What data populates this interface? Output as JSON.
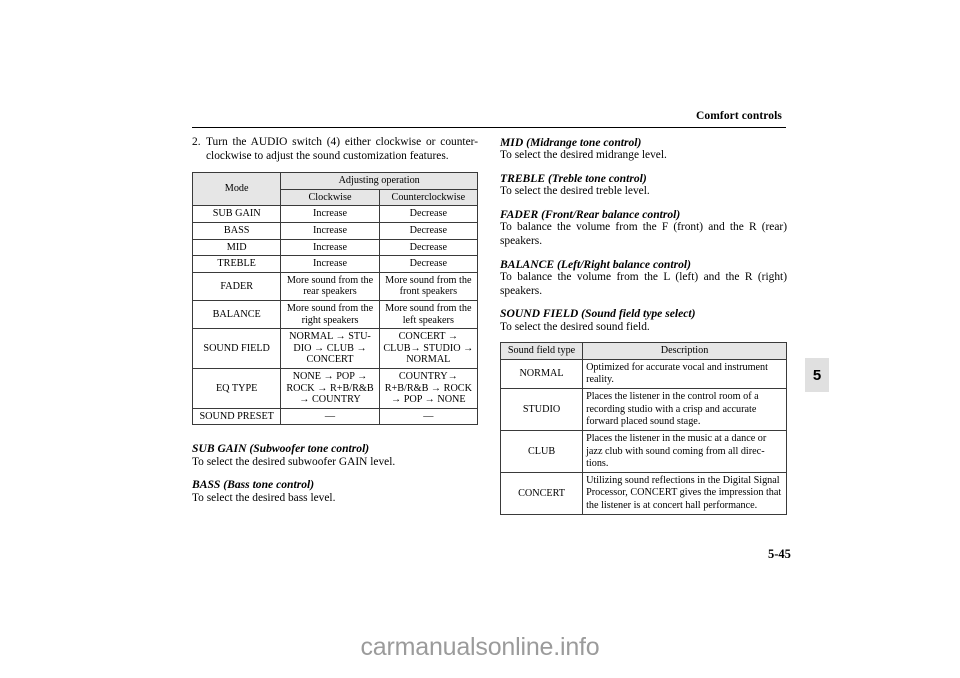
{
  "header": {
    "running_title": "Comfort controls"
  },
  "chapter_tab": {
    "number": "5"
  },
  "footer": {
    "page_number": "5-45",
    "watermark": "carmanualsonline.info"
  },
  "left_column": {
    "step": {
      "number": "2.",
      "text": "Turn the AUDIO switch (4) either clockwise or counter-clockwise to adjust the sound customization features."
    },
    "adjust_table": {
      "header": {
        "mode": "Mode",
        "adjusting_operation": "Adjusting operation",
        "clockwise": "Clockwise",
        "counterclockwise": "Counterclockwise"
      },
      "rows": [
        {
          "mode": "SUB GAIN",
          "clockwise": "Increase",
          "counterclockwise": "Decrease"
        },
        {
          "mode": "BASS",
          "clockwise": "Increase",
          "counterclockwise": "Decrease"
        },
        {
          "mode": "MID",
          "clockwise": "Increase",
          "counterclockwise": "Decrease"
        },
        {
          "mode": "TREBLE",
          "clockwise": "Increase",
          "counterclockwise": "Decrease"
        },
        {
          "mode": "FADER",
          "clockwise": "More sound from the rear speakers",
          "counterclockwise": "More sound from the front speakers"
        },
        {
          "mode": "BALANCE",
          "clockwise": "More sound from the right speakers",
          "counterclockwise": "More sound from the left speakers"
        },
        {
          "mode": "SOUND FIELD",
          "clockwise": "NORMAL → STU-DIO → CLUB → CONCERT",
          "counterclockwise": "CONCERT → CLUB→ STUDIO → NORMAL"
        },
        {
          "mode": "EQ TYPE",
          "clockwise": "NONE → POP → ROCK → R+B/R&B → COUNTRY",
          "counterclockwise": "COUNTRY→ R+B/R&B → ROCK → POP → NONE"
        },
        {
          "mode": "SOUND PRESET",
          "clockwise": "—",
          "counterclockwise": "—"
        }
      ]
    },
    "definitions": [
      {
        "title": "SUB GAIN (Subwoofer tone control)",
        "body": "To select the desired subwoofer GAIN level."
      },
      {
        "title": "BASS (Bass tone control)",
        "body": "To select the desired bass level."
      }
    ]
  },
  "right_column": {
    "definitions": [
      {
        "title": "MID (Midrange tone control)",
        "body": "To select the desired midrange level."
      },
      {
        "title": "TREBLE (Treble tone control)",
        "body": "To select the desired treble level."
      },
      {
        "title": "FADER (Front/Rear balance control)",
        "body": "To balance the volume from the F (front) and the R (rear) speakers."
      },
      {
        "title": "BALANCE (Left/Right balance control)",
        "body": "To balance the volume from the L (left) and the R (right) speakers."
      },
      {
        "title": "SOUND FIELD (Sound field type select)",
        "body": "To select the desired sound field."
      }
    ],
    "sound_field_table": {
      "header": {
        "type": "Sound field type",
        "description": "Description"
      },
      "rows": [
        {
          "type": "NORMAL",
          "description": "Optimized for accurate vocal and instrument reality."
        },
        {
          "type": "STUDIO",
          "description": "Places the listener in the control room of a recording studio with a crisp and accurate forward placed sound stage."
        },
        {
          "type": "CLUB",
          "description": "Places the listener in the music at a dance or jazz club with sound coming from all direc-tions."
        },
        {
          "type": "CONCERT",
          "description": "Utilizing sound reflections in the Digital Signal Processor, CONCERT gives the impression that the listener is at concert hall performance."
        }
      ]
    }
  }
}
